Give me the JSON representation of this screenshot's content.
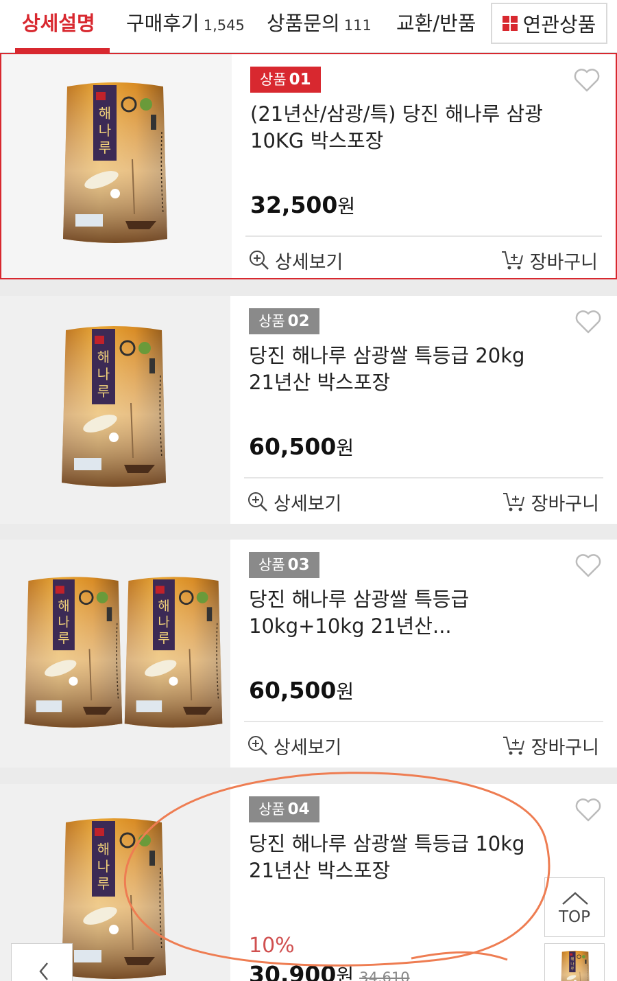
{
  "tabs": {
    "detail": "상세설명",
    "reviews": "구매후기",
    "reviews_count": "1,545",
    "inquiry": "상품문의",
    "inquiry_count": "111",
    "exchange": "교환/반품",
    "related": "연관상품"
  },
  "products": [
    {
      "badge_label": "상품",
      "badge_num": "01",
      "name": "(21년산/삼광/특) 당진 해나루 삼광 10KG 박스포장",
      "price": "32,500",
      "currency": "원",
      "detail_label": "상세보기",
      "cart_label": "장바구니"
    },
    {
      "badge_label": "상품",
      "badge_num": "02",
      "name": "당진 해나루 삼광쌀 특등급 20kg 21년산 박스포장",
      "price": "60,500",
      "currency": "원",
      "detail_label": "상세보기",
      "cart_label": "장바구니"
    },
    {
      "badge_label": "상품",
      "badge_num": "03",
      "name": "당진 해나루 삼광쌀 특등급10kg+10kg 21년산...",
      "price": "60,500",
      "currency": "원",
      "detail_label": "상세보기",
      "cart_label": "장바구니"
    },
    {
      "badge_label": "상품",
      "badge_num": "04",
      "name": "당진 해나루 삼광쌀 특등급 10kg 21년산 박스포장",
      "discount": "10%",
      "price": "30,900",
      "currency": "원",
      "original_price": "34,610"
    }
  ],
  "floating": {
    "top_label": "TOP"
  },
  "colors": {
    "accent": "#d8282f",
    "annotation": "#ee7d52"
  }
}
